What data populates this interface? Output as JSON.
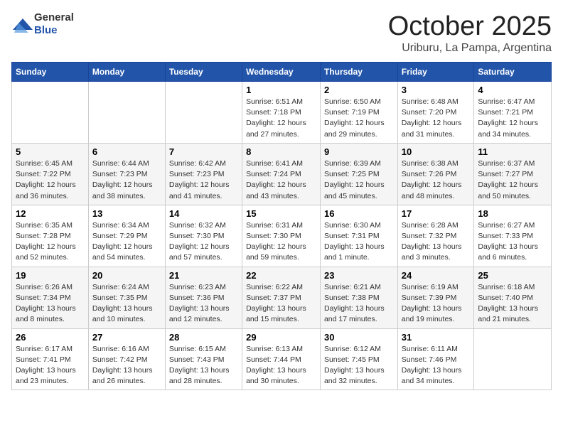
{
  "header": {
    "logo_general": "General",
    "logo_blue": "Blue",
    "month": "October 2025",
    "location": "Uriburu, La Pampa, Argentina"
  },
  "days_of_week": [
    "Sunday",
    "Monday",
    "Tuesday",
    "Wednesday",
    "Thursday",
    "Friday",
    "Saturday"
  ],
  "weeks": [
    [
      {
        "day": "",
        "sunrise": "",
        "sunset": "",
        "daylight": ""
      },
      {
        "day": "",
        "sunrise": "",
        "sunset": "",
        "daylight": ""
      },
      {
        "day": "",
        "sunrise": "",
        "sunset": "",
        "daylight": ""
      },
      {
        "day": "1",
        "sunrise": "Sunrise: 6:51 AM",
        "sunset": "Sunset: 7:18 PM",
        "daylight": "Daylight: 12 hours and 27 minutes."
      },
      {
        "day": "2",
        "sunrise": "Sunrise: 6:50 AM",
        "sunset": "Sunset: 7:19 PM",
        "daylight": "Daylight: 12 hours and 29 minutes."
      },
      {
        "day": "3",
        "sunrise": "Sunrise: 6:48 AM",
        "sunset": "Sunset: 7:20 PM",
        "daylight": "Daylight: 12 hours and 31 minutes."
      },
      {
        "day": "4",
        "sunrise": "Sunrise: 6:47 AM",
        "sunset": "Sunset: 7:21 PM",
        "daylight": "Daylight: 12 hours and 34 minutes."
      }
    ],
    [
      {
        "day": "5",
        "sunrise": "Sunrise: 6:45 AM",
        "sunset": "Sunset: 7:22 PM",
        "daylight": "Daylight: 12 hours and 36 minutes."
      },
      {
        "day": "6",
        "sunrise": "Sunrise: 6:44 AM",
        "sunset": "Sunset: 7:23 PM",
        "daylight": "Daylight: 12 hours and 38 minutes."
      },
      {
        "day": "7",
        "sunrise": "Sunrise: 6:42 AM",
        "sunset": "Sunset: 7:23 PM",
        "daylight": "Daylight: 12 hours and 41 minutes."
      },
      {
        "day": "8",
        "sunrise": "Sunrise: 6:41 AM",
        "sunset": "Sunset: 7:24 PM",
        "daylight": "Daylight: 12 hours and 43 minutes."
      },
      {
        "day": "9",
        "sunrise": "Sunrise: 6:39 AM",
        "sunset": "Sunset: 7:25 PM",
        "daylight": "Daylight: 12 hours and 45 minutes."
      },
      {
        "day": "10",
        "sunrise": "Sunrise: 6:38 AM",
        "sunset": "Sunset: 7:26 PM",
        "daylight": "Daylight: 12 hours and 48 minutes."
      },
      {
        "day": "11",
        "sunrise": "Sunrise: 6:37 AM",
        "sunset": "Sunset: 7:27 PM",
        "daylight": "Daylight: 12 hours and 50 minutes."
      }
    ],
    [
      {
        "day": "12",
        "sunrise": "Sunrise: 6:35 AM",
        "sunset": "Sunset: 7:28 PM",
        "daylight": "Daylight: 12 hours and 52 minutes."
      },
      {
        "day": "13",
        "sunrise": "Sunrise: 6:34 AM",
        "sunset": "Sunset: 7:29 PM",
        "daylight": "Daylight: 12 hours and 54 minutes."
      },
      {
        "day": "14",
        "sunrise": "Sunrise: 6:32 AM",
        "sunset": "Sunset: 7:30 PM",
        "daylight": "Daylight: 12 hours and 57 minutes."
      },
      {
        "day": "15",
        "sunrise": "Sunrise: 6:31 AM",
        "sunset": "Sunset: 7:30 PM",
        "daylight": "Daylight: 12 hours and 59 minutes."
      },
      {
        "day": "16",
        "sunrise": "Sunrise: 6:30 AM",
        "sunset": "Sunset: 7:31 PM",
        "daylight": "Daylight: 13 hours and 1 minute."
      },
      {
        "day": "17",
        "sunrise": "Sunrise: 6:28 AM",
        "sunset": "Sunset: 7:32 PM",
        "daylight": "Daylight: 13 hours and 3 minutes."
      },
      {
        "day": "18",
        "sunrise": "Sunrise: 6:27 AM",
        "sunset": "Sunset: 7:33 PM",
        "daylight": "Daylight: 13 hours and 6 minutes."
      }
    ],
    [
      {
        "day": "19",
        "sunrise": "Sunrise: 6:26 AM",
        "sunset": "Sunset: 7:34 PM",
        "daylight": "Daylight: 13 hours and 8 minutes."
      },
      {
        "day": "20",
        "sunrise": "Sunrise: 6:24 AM",
        "sunset": "Sunset: 7:35 PM",
        "daylight": "Daylight: 13 hours and 10 minutes."
      },
      {
        "day": "21",
        "sunrise": "Sunrise: 6:23 AM",
        "sunset": "Sunset: 7:36 PM",
        "daylight": "Daylight: 13 hours and 12 minutes."
      },
      {
        "day": "22",
        "sunrise": "Sunrise: 6:22 AM",
        "sunset": "Sunset: 7:37 PM",
        "daylight": "Daylight: 13 hours and 15 minutes."
      },
      {
        "day": "23",
        "sunrise": "Sunrise: 6:21 AM",
        "sunset": "Sunset: 7:38 PM",
        "daylight": "Daylight: 13 hours and 17 minutes."
      },
      {
        "day": "24",
        "sunrise": "Sunrise: 6:19 AM",
        "sunset": "Sunset: 7:39 PM",
        "daylight": "Daylight: 13 hours and 19 minutes."
      },
      {
        "day": "25",
        "sunrise": "Sunrise: 6:18 AM",
        "sunset": "Sunset: 7:40 PM",
        "daylight": "Daylight: 13 hours and 21 minutes."
      }
    ],
    [
      {
        "day": "26",
        "sunrise": "Sunrise: 6:17 AM",
        "sunset": "Sunset: 7:41 PM",
        "daylight": "Daylight: 13 hours and 23 minutes."
      },
      {
        "day": "27",
        "sunrise": "Sunrise: 6:16 AM",
        "sunset": "Sunset: 7:42 PM",
        "daylight": "Daylight: 13 hours and 26 minutes."
      },
      {
        "day": "28",
        "sunrise": "Sunrise: 6:15 AM",
        "sunset": "Sunset: 7:43 PM",
        "daylight": "Daylight: 13 hours and 28 minutes."
      },
      {
        "day": "29",
        "sunrise": "Sunrise: 6:13 AM",
        "sunset": "Sunset: 7:44 PM",
        "daylight": "Daylight: 13 hours and 30 minutes."
      },
      {
        "day": "30",
        "sunrise": "Sunrise: 6:12 AM",
        "sunset": "Sunset: 7:45 PM",
        "daylight": "Daylight: 13 hours and 32 minutes."
      },
      {
        "day": "31",
        "sunrise": "Sunrise: 6:11 AM",
        "sunset": "Sunset: 7:46 PM",
        "daylight": "Daylight: 13 hours and 34 minutes."
      },
      {
        "day": "",
        "sunrise": "",
        "sunset": "",
        "daylight": ""
      }
    ]
  ]
}
